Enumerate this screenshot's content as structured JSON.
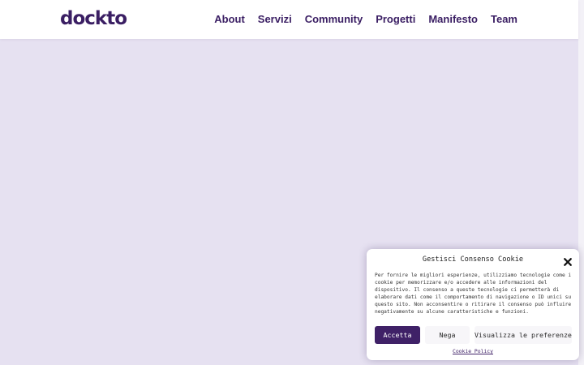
{
  "header": {
    "logo_text": "dockto",
    "nav": [
      {
        "label": "About"
      },
      {
        "label": "Servizi"
      },
      {
        "label": "Community"
      },
      {
        "label": "Progetti"
      },
      {
        "label": "Manifesto"
      },
      {
        "label": "Team"
      }
    ]
  },
  "cookie_banner": {
    "title": "Gestisci Consenso Cookie",
    "message": "Per fornire le migliori esperienze, utilizziamo tecnologie come i cookie per memorizzare e/o accedere alle informazioni del dispositivo. Il consenso a queste tecnologie ci permetterà di elaborare dati come il comportamento di navigazione o ID unici su questo sito. Non acconsentire o ritirare il consenso può influire negativamente su alcune caratteristiche e funzioni.",
    "accept_label": "Accetta",
    "deny_label": "Nega",
    "preferences_label": "Visualizza le preferenze",
    "policy_link": "Cookie Policy"
  },
  "icons": {
    "close": "close-icon"
  },
  "colors": {
    "brand": "#3a1e63",
    "page_background": "#e6e1f1",
    "accept_button": "#3f2167",
    "secondary_button": "#f7f6f9"
  }
}
